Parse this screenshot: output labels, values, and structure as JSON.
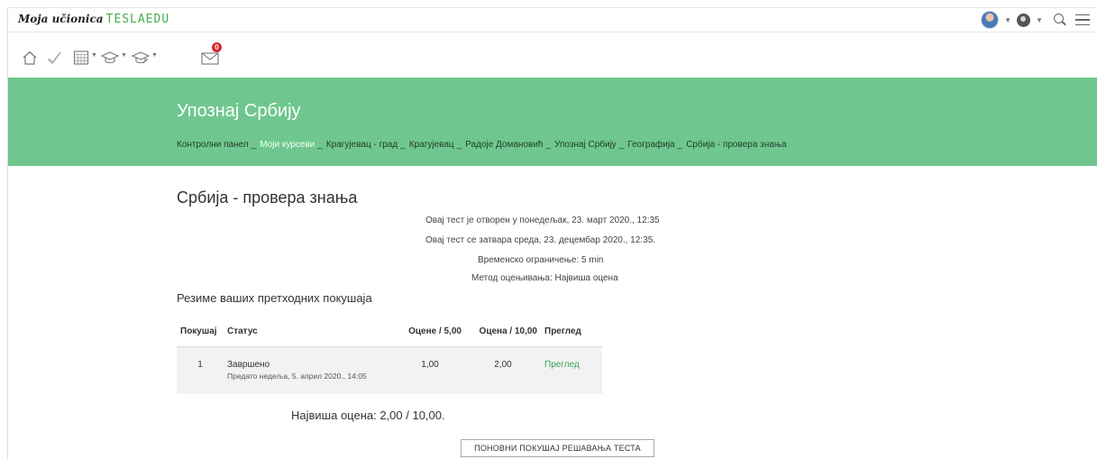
{
  "brand": {
    "moja": "Moja učionica",
    "tesla": "TESLAEDU"
  },
  "header": {
    "title": "Упознај Србију",
    "breadcrumb": [
      {
        "label": "Контролни панел",
        "light": false
      },
      {
        "label": "Моји курсеви",
        "light": true
      },
      {
        "label": "Крагујевац - град",
        "light": false
      },
      {
        "label": "Крагујевац",
        "light": false
      },
      {
        "label": "Радоје Домановић",
        "light": false
      },
      {
        "label": "Упознај Србију",
        "light": false
      },
      {
        "label": "Географија",
        "light": false
      },
      {
        "label": "Србија - провера знања",
        "light": false
      }
    ],
    "separator": "_"
  },
  "toolbar": {
    "messages_count": "0"
  },
  "quiz": {
    "title": "Србија - провера знања",
    "opened": "Овај тест је отворен у понедељак, 23. март 2020., 12:35",
    "closes": "Овај тест се затвара среда, 23. децембар 2020., 12:35.",
    "time_limit": "Временско ограничење: 5 min",
    "grading_method": "Метод оцењивања: Највиша оцена"
  },
  "summary": {
    "title": "Резиме ваших претходних покушаја",
    "columns": [
      "Покушај",
      "Статус",
      "Оцене / 5,00",
      "Оцена / 10,00",
      "Преглед"
    ],
    "rows": [
      {
        "attempt": "1",
        "status": "Завршено",
        "submitted": "Предато недеља, 5. април 2020., 14:05",
        "marks": "1,00",
        "grade": "2,00",
        "review": "Преглед"
      }
    ]
  },
  "highest_grade": "Највиша оцена: 2,00 / 10,00.",
  "retry_button": "ПОНОВНИ ПОКУШАЈ РЕШАВАЊА ТЕСТА",
  "colors": {
    "accent_green": "#6fc78f",
    "link_green": "#3aa457",
    "badge_red": "#d9252a"
  }
}
